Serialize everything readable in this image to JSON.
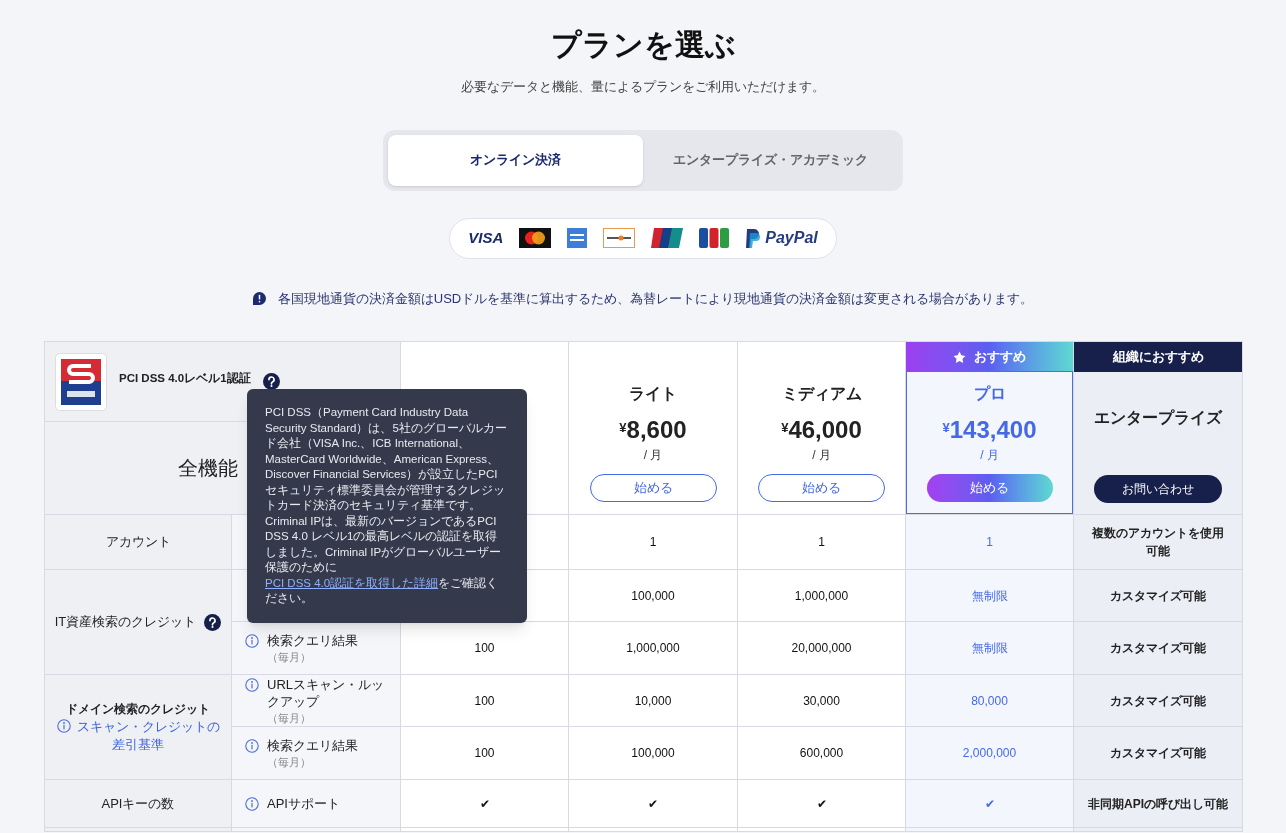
{
  "title": "プランを選ぶ",
  "subtitle": "必要なデータと機能、量によるプランをご利用いただけます。",
  "tabs": [
    {
      "label": "オンライン決済",
      "selected": true
    },
    {
      "label": "エンタープライズ・アカデミック",
      "selected": false
    }
  ],
  "payment_logos": [
    {
      "kind": "visa",
      "label": "VISA"
    },
    {
      "kind": "mastercard"
    },
    {
      "kind": "amex"
    },
    {
      "kind": "discover"
    },
    {
      "kind": "unionpay"
    },
    {
      "kind": "jcb"
    },
    {
      "kind": "paypal",
      "label": "PayPal"
    }
  ],
  "notice": "各国現地通貨の決済金額はUSDドルを基準に算出するため、為替レートにより現地通貨の決済金額は変更される場合があります。",
  "certification": {
    "label": "PCI DSS 4.0レベル1認証"
  },
  "feature_header": "全機能",
  "plans": [
    {
      "kind": "hidden"
    },
    {
      "kind": "standard",
      "name": "ライト",
      "price": "8,600",
      "currency": "¥",
      "period": "/ 月",
      "button": "始める"
    },
    {
      "kind": "standard",
      "name": "ミディアム",
      "price": "46,000",
      "currency": "¥",
      "period": "/ 月",
      "button": "始める"
    },
    {
      "kind": "featured",
      "badge": "おすすめ",
      "name": "プロ",
      "price": "143,400",
      "currency": "¥",
      "period": "/ 月",
      "button": "始める"
    },
    {
      "kind": "enterprise",
      "badge": "組織におすすめ",
      "name": "エンタープライズ",
      "button": "お問い合わせ"
    }
  ],
  "groups": [
    {
      "label": "アカウント",
      "rows": [
        {
          "cells": [
            null,
            "1",
            "1",
            "1",
            "複数のアカウントを使用可能"
          ]
        }
      ]
    },
    {
      "label": "IT資産検索のクレジット",
      "help": true,
      "rows": [
        {
          "cells": [
            null,
            "100,000",
            "1,000,000",
            "無制限",
            "カスタマイズ可能"
          ]
        },
        {
          "label": "検索クエリ結果",
          "note": "（毎月）",
          "cells": [
            "100",
            "1,000,000",
            "20,000,000",
            "無制限",
            "カスタマイズ可能"
          ]
        }
      ]
    },
    {
      "label": "ドメイン検索のクレジット",
      "link": "スキャン・クレジットの差引基準",
      "rows": [
        {
          "label": "URLスキャン・ルックアップ",
          "note": "（毎月）",
          "cells": [
            "100",
            "10,000",
            "30,000",
            "80,000",
            "カスタマイズ可能"
          ]
        },
        {
          "label": "検索クエリ結果",
          "note": "（毎月）",
          "cells": [
            "100",
            "100,000",
            "600,000",
            "2,000,000",
            "カスタマイズ可能"
          ]
        }
      ]
    },
    {
      "label": "APIキーの数",
      "rows": [
        {
          "label": "APIサポート",
          "cells": [
            "✔",
            "✔",
            "✔",
            "✔",
            "非同期APIの呼び出し可能"
          ]
        }
      ]
    }
  ],
  "tooltip": {
    "text": "PCI DSS（Payment Card Industry Data Security Standard）は、5社のグローバルカード会社（VISA Inc.、ICB International、MasterCard Worldwide、American Express、Discover Financial Services）が設立したPCIセキュリティ標準委員会が管理するクレジットカード決済のセキュリティ基準です。Criminal IPは、最新のバージョンであるPCI DSS 4.0 レベル1の最高レベルの認証を取得しました。Criminal IPがグローバルユーザー保護のために",
    "link": "PCI DSS 4.0認証を取得した詳細",
    "text_after": "をご確認ください。"
  }
}
